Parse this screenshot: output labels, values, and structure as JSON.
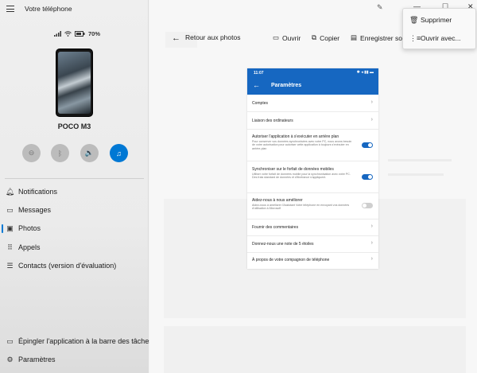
{
  "app": {
    "title": "Votre téléphone"
  },
  "status": {
    "battery": "70%"
  },
  "device": {
    "name": "POCO M3"
  },
  "quick_actions": [
    {
      "name": "do-not-disturb"
    },
    {
      "name": "bluetooth"
    },
    {
      "name": "volume"
    },
    {
      "name": "music"
    }
  ],
  "nav": {
    "notifications": "Notifications",
    "messages": "Messages",
    "photos": "Photos",
    "calls": "Appels",
    "contacts": "Contacts (version d'évaluation)",
    "pin": "Épingler l'application à la barre des tâches",
    "settings": "Paramètres"
  },
  "toolbar": {
    "back": "Retour aux photos",
    "open": "Ouvrir",
    "copy": "Copier",
    "save": "Enregistrer sous"
  },
  "context_menu": {
    "delete": "Supprimer",
    "open_with": "Ouvrir avec..."
  },
  "screenshot": {
    "time": "11:07",
    "title": "Paramètres",
    "rows": [
      {
        "title": "Comptes"
      },
      {
        "title": "Liaison des ordinateurs"
      },
      {
        "title": "Autoriser l'application à s'exécuter en arrière plan",
        "desc": "Pour conserver vos données synchronisées avec votre PC, nous avons besoin de votre autorisation pour autoriser cette application à toujours s'exécuter en arrière-plan"
      },
      {
        "title": "Synchroniser sur le forfait de données mobiles",
        "desc": "Utiliser votre forfait de données mobile pour la synchronisation avec votre PC. Des frais standard de données et d'itinérance s'appliquent."
      },
      {
        "title": "Aidez-nous à nous améliorer",
        "desc": "Aidez-nous à améliorer l'Assistant Votre téléphone en envoyant vos données d'utilisation à Microsoft"
      },
      {
        "title": "Fournir des commentaires"
      },
      {
        "title": "Donnez-nous une note de 5 étoiles"
      },
      {
        "title": "À propos de votre compagnon de téléphone"
      }
    ]
  },
  "colors": {
    "accent": "#0078d4",
    "phone_bar": "#1667c1"
  }
}
